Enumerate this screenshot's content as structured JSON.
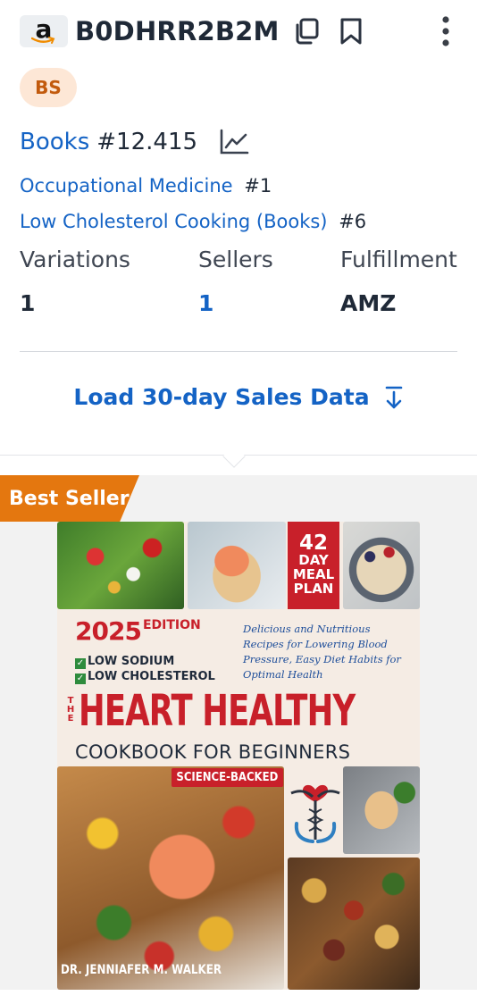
{
  "header": {
    "asin": "B0DHRR2B2M",
    "logo_letter": "a",
    "icons": [
      "amazon-logo",
      "copy-icon",
      "bookmark-icon",
      "more-vertical-icon"
    ]
  },
  "badge": {
    "label": "BS"
  },
  "rank": {
    "category": "Books",
    "value": "#12.415",
    "subranks": [
      {
        "category": "Occupational Medicine",
        "value": "#1"
      },
      {
        "category": "Low Cholesterol Cooking (Books)",
        "value": "#6"
      }
    ]
  },
  "stats": [
    {
      "label": "Variations",
      "value": "1",
      "link": false
    },
    {
      "label": "Sellers",
      "value": "1",
      "link": true
    },
    {
      "label": "Fulfillment",
      "value": "AMZ",
      "link": false
    }
  ],
  "load_button": {
    "label": "Load 30-day Sales Data"
  },
  "product_image": {
    "best_seller_label": "Best Seller",
    "cover": {
      "meal_plan_number": "42",
      "meal_plan_text": [
        "DAY",
        "MEAL",
        "PLAN"
      ],
      "edition_year": "2025",
      "edition_label": "EDITION",
      "checks": [
        "LOW SODIUM",
        "LOW CHOLESTEROL"
      ],
      "tagline": "Delicious and Nutritious Recipes for Lowering Blood Pressure, Easy Diet Habits for Optimal Health",
      "the": "THE",
      "title": "HEART HEALTHY",
      "subtitle": "COOKBOOK FOR BEGINNERS",
      "science_badge": "SCIENCE-BACKED",
      "author": "DR. JENNIAFER M. WALKER"
    }
  },
  "colors": {
    "link": "#1463c5",
    "text": "#1f2937",
    "badge_bg": "#fde7d6",
    "badge_text": "#c25a0d",
    "best_seller": "#e4770f",
    "cover_red": "#c8202a"
  }
}
